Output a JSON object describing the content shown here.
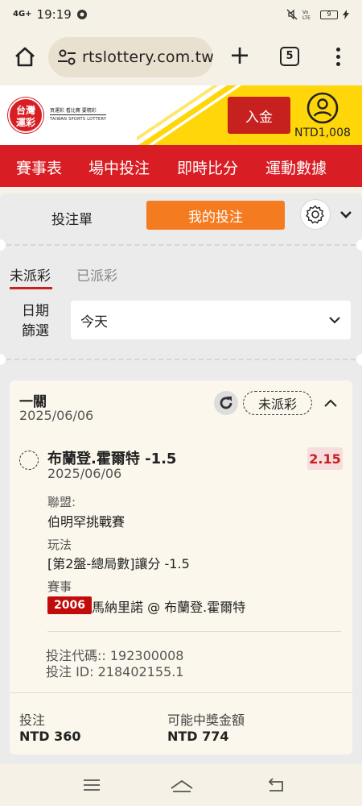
{
  "status_bar": {
    "network": "4G+",
    "time": "19:19",
    "battery": "9"
  },
  "browser": {
    "url": "rtslottery.com.tw",
    "tab_count": "5"
  },
  "header": {
    "logo_text": "台灣\n運彩",
    "logo_slogan": "買運彩 看比賽 要精彩",
    "logo_en": "TAIWAN SPORTS LOTTERY",
    "deposit_label": "入金",
    "balance": "NTD1,008"
  },
  "nav": {
    "items": [
      "賽事表",
      "場中投注",
      "即時比分",
      "運動數據"
    ]
  },
  "panel": {
    "tab_betslip": "投注單",
    "tab_mybets": "我的投注",
    "status_unsettled": "未派彩",
    "status_settled": "已派彩",
    "date_filter_label": "日期\n篩選",
    "date_filter_value": "今天"
  },
  "bet": {
    "type": "一關",
    "date": "2025/06/06",
    "status": "未派彩",
    "selection": "布蘭登.霍爾特 -1.5",
    "selection_date": "2025/06/06",
    "odds": "2.15",
    "league_label": "聯盟:",
    "league": "伯明罕挑戰賽",
    "market_label": "玩法",
    "market": "[第2盤-總局數]讓分 -1.5",
    "event_label": "賽事",
    "event_code": "2006",
    "event_name": "馬納里諾 @ 布蘭登.霍爾特",
    "bet_code": "投注代碼:: 192300008",
    "bet_id": "投注 ID: 218402155.1",
    "stake_label": "投注",
    "stake": "NTD 360",
    "payout_label": "可能中獎金額",
    "payout": "NTD 774"
  },
  "colors": {
    "brand_red": "#d81e24",
    "accent_orange": "#f47b20",
    "yellow": "#ffd60a"
  }
}
